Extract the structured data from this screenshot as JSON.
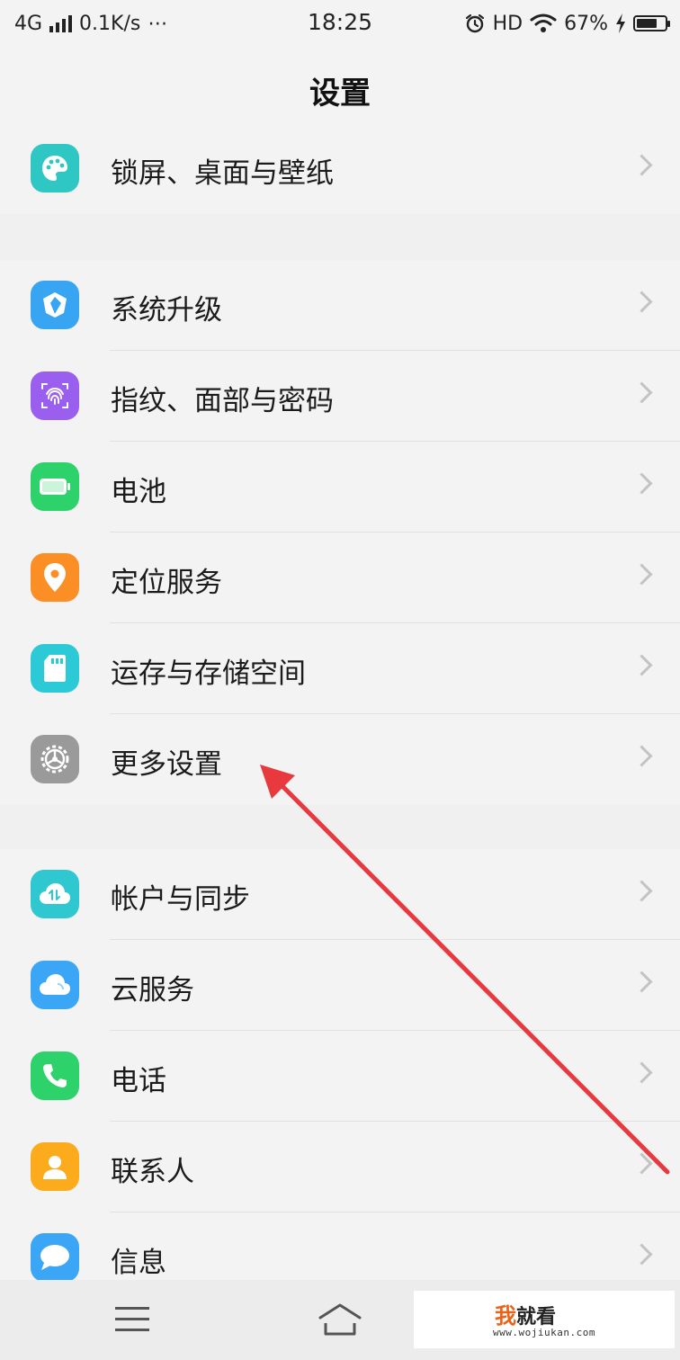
{
  "status_bar": {
    "network": "4G",
    "speed": "0.1K/s",
    "dots": "⋯",
    "time": "18:25",
    "hd": "HD",
    "battery": "67%",
    "battery_level": 0.67
  },
  "header": {
    "title": "设置"
  },
  "groups": [
    {
      "items": [
        {
          "label": "锁屏、桌面与壁纸",
          "icon": "palette-icon",
          "color": "#2fc7c3"
        }
      ]
    },
    {
      "items": [
        {
          "label": "系统升级",
          "icon": "upgrade-icon",
          "color": "#38a5f2"
        },
        {
          "label": "指纹、面部与密码",
          "icon": "fingerprint-icon",
          "color": "#9b5ff0"
        },
        {
          "label": "电池",
          "icon": "battery-icon",
          "color": "#2ed26a"
        },
        {
          "label": "定位服务",
          "icon": "location-icon",
          "color": "#fb8e25"
        },
        {
          "label": "运存与存储空间",
          "icon": "sd-card-icon",
          "color": "#2cc9d6"
        },
        {
          "label": "更多设置",
          "icon": "gear-icon",
          "color": "#9a9a9a"
        }
      ]
    },
    {
      "items": [
        {
          "label": "帐户与同步",
          "icon": "cloud-sync-icon",
          "color": "#2fc7d0"
        },
        {
          "label": "云服务",
          "icon": "cloud-icon",
          "color": "#3aa6f5"
        },
        {
          "label": "电话",
          "icon": "phone-icon",
          "color": "#2ed26a"
        },
        {
          "label": "联系人",
          "icon": "contact-icon",
          "color": "#fbab1b"
        },
        {
          "label": "信息",
          "icon": "message-icon",
          "color": "#3aa6f5"
        }
      ]
    }
  ],
  "watermark": {
    "accent": "我",
    "text": "就看",
    "url": "www.wojiukan.com"
  }
}
